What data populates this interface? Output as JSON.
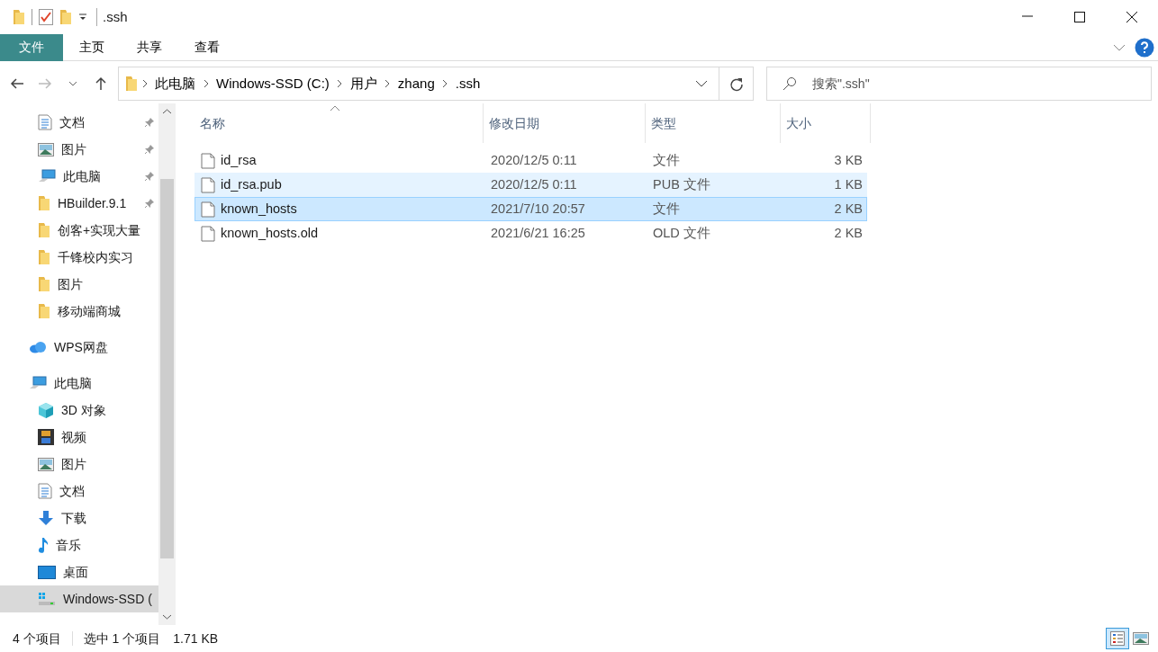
{
  "window": {
    "title": ".ssh"
  },
  "ribbon_tabs": [
    {
      "label": "文件",
      "kind": "file"
    },
    {
      "label": "主页",
      "kind": "tab"
    },
    {
      "label": "共享",
      "kind": "tab"
    },
    {
      "label": "查看",
      "kind": "tab"
    }
  ],
  "address_bar": {
    "segments": [
      "此电脑",
      "Windows-SSD (C:)",
      "用户",
      "zhang",
      ".ssh"
    ]
  },
  "search": {
    "placeholder": "搜索\".ssh\""
  },
  "sidebar": {
    "items": [
      {
        "label": "文档",
        "kind": "doc",
        "pinned": true,
        "selected": false
      },
      {
        "label": "图片",
        "kind": "picture",
        "pinned": true,
        "selected": false
      },
      {
        "label": "此电脑",
        "kind": "pc",
        "pinned": true,
        "selected": false
      },
      {
        "label": "HBuilder.9.1",
        "kind": "folder",
        "pinned": true,
        "selected": false
      },
      {
        "label": "创客+实现大量",
        "kind": "folder",
        "pinned": false,
        "selected": false
      },
      {
        "label": "千锋校内实习",
        "kind": "folder",
        "pinned": false,
        "selected": false
      },
      {
        "label": "图片",
        "kind": "folder",
        "pinned": false,
        "selected": false
      },
      {
        "label": "移动端商城",
        "kind": "folder",
        "pinned": false,
        "selected": false
      },
      {
        "label": "WPS网盘",
        "kind": "cloud",
        "pinned": false,
        "selected": false,
        "root": true
      },
      {
        "label": "此电脑",
        "kind": "pc",
        "pinned": false,
        "selected": false,
        "root": true,
        "children": [
          {
            "label": "3D 对象",
            "kind": "cube",
            "pinned": false,
            "selected": false
          },
          {
            "label": "视频",
            "kind": "video",
            "pinned": false,
            "selected": false
          },
          {
            "label": "图片",
            "kind": "picture",
            "pinned": false,
            "selected": false
          },
          {
            "label": "文档",
            "kind": "doc",
            "pinned": false,
            "selected": false
          },
          {
            "label": "下载",
            "kind": "download",
            "pinned": false,
            "selected": false
          },
          {
            "label": "音乐",
            "kind": "music",
            "pinned": false,
            "selected": false
          },
          {
            "label": "桌面",
            "kind": "desktop",
            "pinned": false,
            "selected": false
          },
          {
            "label": "Windows-SSD (",
            "kind": "drive",
            "pinned": false,
            "selected": true
          }
        ]
      }
    ]
  },
  "table": {
    "columns": [
      "名称",
      "修改日期",
      "类型",
      "大小"
    ],
    "rows": [
      {
        "name": "id_rsa",
        "date": "2020/12/5 0:11",
        "type": "文件",
        "size": "3 KB",
        "selected": false,
        "hovered": false
      },
      {
        "name": "id_rsa.pub",
        "date": "2020/12/5 0:11",
        "type": "PUB 文件",
        "size": "1 KB",
        "selected": false,
        "hovered": true
      },
      {
        "name": "known_hosts",
        "date": "2021/7/10 20:57",
        "type": "文件",
        "size": "2 KB",
        "selected": true,
        "hovered": false
      },
      {
        "name": "known_hosts.old",
        "date": "2021/6/21 16:25",
        "type": "OLD 文件",
        "size": "2 KB",
        "selected": false,
        "hovered": false
      }
    ]
  },
  "status_bar": {
    "count": "4 个项目",
    "selection": "选中 1 个项目",
    "size": "1.71 KB"
  },
  "view_buttons": [
    {
      "kind": "details",
      "selected": true
    },
    {
      "kind": "thumbnails",
      "selected": false
    }
  ]
}
